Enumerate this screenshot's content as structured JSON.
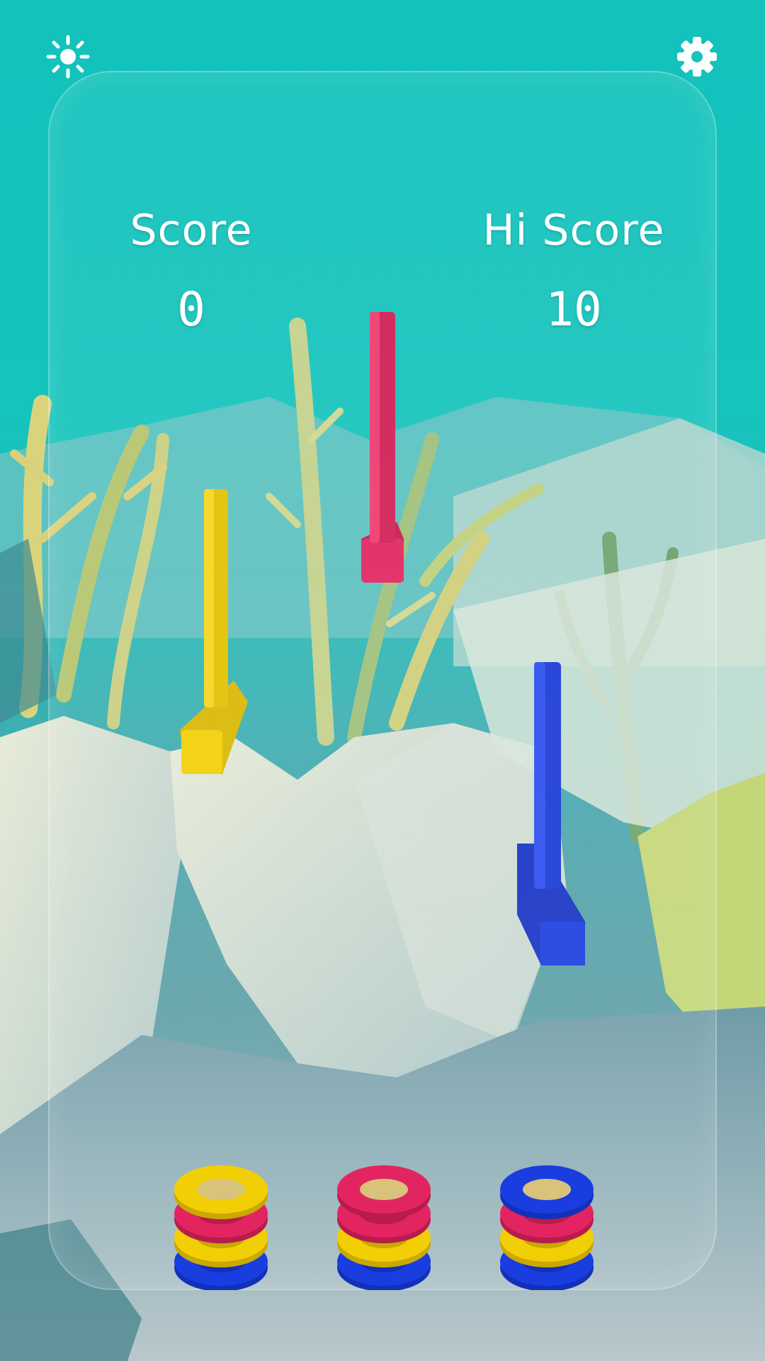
{
  "hud": {
    "brightness_icon": "sun-icon",
    "settings_icon": "gear-icon",
    "score_label": "Score",
    "score_value": "0",
    "hiscore_label": "Hi Score",
    "hiscore_value": "10"
  },
  "colors": {
    "water": "#15c4bd",
    "yellow": "#f2cf05",
    "red": "#e22560",
    "blue": "#1a3de0",
    "sand": "#aebfc6"
  },
  "pegs": [
    {
      "color": "yellow"
    },
    {
      "color": "red"
    },
    {
      "color": "blue"
    }
  ],
  "ring_stacks": [
    {
      "rings_bottom_to_top": [
        "blue",
        "yellow",
        "red",
        "yellow"
      ]
    },
    {
      "rings_bottom_to_top": [
        "blue",
        "yellow",
        "red",
        "red"
      ]
    },
    {
      "rings_bottom_to_top": [
        "blue",
        "yellow",
        "red",
        "blue"
      ]
    }
  ]
}
